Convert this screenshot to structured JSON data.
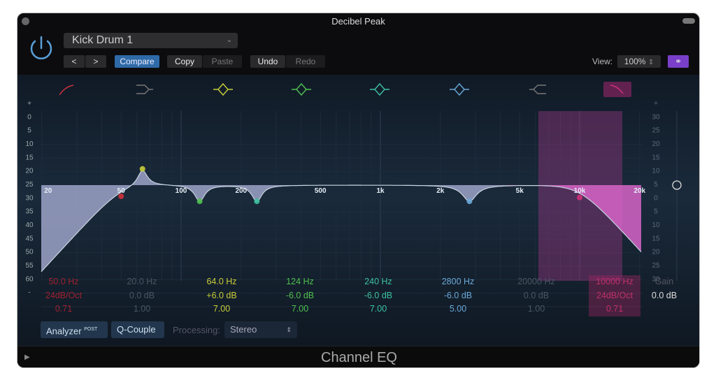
{
  "window": {
    "title": "Decibel Peak"
  },
  "header": {
    "preset": "Kick Drum 1",
    "prev": "<",
    "next": ">",
    "compare": "Compare",
    "copy": "Copy",
    "paste": "Paste",
    "undo": "Undo",
    "redo": "Redo",
    "view_label": "View:",
    "view_value": "100%"
  },
  "graph": {
    "left_scale": [
      "+",
      "0",
      "5",
      "10",
      "15",
      "20",
      "25",
      "30",
      "35",
      "40",
      "45",
      "50",
      "55",
      "60",
      "-"
    ],
    "right_scale": [
      "+",
      "30",
      "25",
      "20",
      "15",
      "10",
      "5",
      "0",
      "5",
      "10",
      "15",
      "20",
      "25",
      "30",
      "-"
    ],
    "freq_labels": [
      {
        "f": 20,
        "t": "20"
      },
      {
        "f": 50,
        "t": "50"
      },
      {
        "f": 100,
        "t": "100"
      },
      {
        "f": 200,
        "t": "200"
      },
      {
        "f": 500,
        "t": "500"
      },
      {
        "f": 1000,
        "t": "1k"
      },
      {
        "f": 2000,
        "t": "2k"
      },
      {
        "f": 5000,
        "t": "5k"
      },
      {
        "f": 10000,
        "t": "10k"
      },
      {
        "f": 20000,
        "t": "20k"
      }
    ]
  },
  "bands": [
    {
      "type": "low-cut",
      "enabled": true,
      "color": "#d0303a",
      "freq": "50.0 Hz",
      "gain": "24dB/Oct",
      "q": "0.71",
      "f": 50
    },
    {
      "type": "low-shelf",
      "enabled": false,
      "color": "#777777",
      "freq": "20.0 Hz",
      "gain": "0.0 dB",
      "q": "1.00",
      "f": 20
    },
    {
      "type": "bell",
      "enabled": true,
      "color": "#c9cc3a",
      "freq": "64.0 Hz",
      "gain": "+6.0 dB",
      "q": "7.00",
      "f": 64,
      "g": 6,
      "Q": 7
    },
    {
      "type": "bell",
      "enabled": true,
      "color": "#4fc04f",
      "freq": "124 Hz",
      "gain": "-6.0 dB",
      "q": "7.00",
      "f": 124,
      "g": -6,
      "Q": 7
    },
    {
      "type": "bell",
      "enabled": true,
      "color": "#3cc0a0",
      "freq": "240 Hz",
      "gain": "-6.0 dB",
      "q": "7.00",
      "f": 240,
      "g": -6,
      "Q": 7
    },
    {
      "type": "bell",
      "enabled": true,
      "color": "#6aa8d8",
      "freq": "2800 Hz",
      "gain": "-6.0 dB",
      "q": "5.00",
      "f": 2800,
      "g": -6,
      "Q": 5
    },
    {
      "type": "high-shelf",
      "enabled": false,
      "color": "#777777",
      "freq": "20000 Hz",
      "gain": "0.0 dB",
      "q": "1.00",
      "f": 20000
    },
    {
      "type": "high-cut",
      "enabled": true,
      "color": "#d0307a",
      "freq": "10000 Hz",
      "gain": "24dB/Oct",
      "q": "0.71",
      "f": 10000,
      "selected": true
    }
  ],
  "gain": {
    "label": "Gain",
    "value": "0.0 dB"
  },
  "bottom": {
    "analyzer": "Analyzer",
    "post": "POST",
    "qcouple": "Q-Couple",
    "processing_label": "Processing:",
    "processing_value": "Stereo"
  },
  "footer": {
    "name": "Channel EQ"
  }
}
